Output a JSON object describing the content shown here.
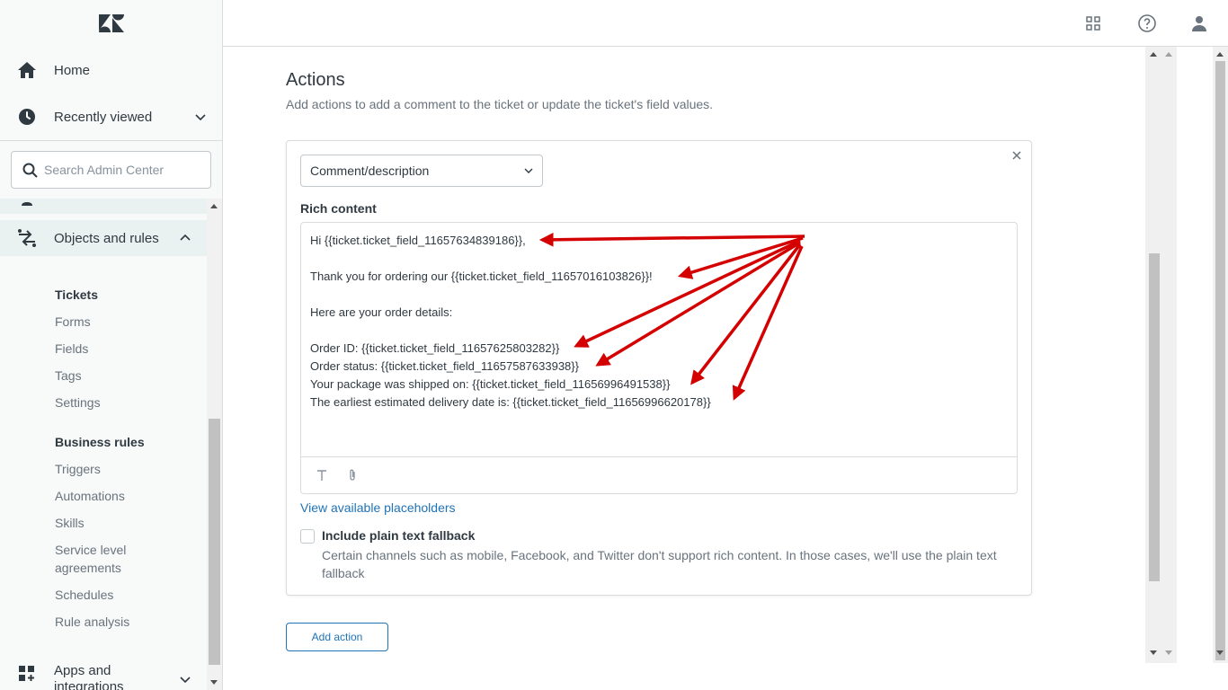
{
  "sidebar": {
    "logo": "zendesk-logo",
    "home_label": "Home",
    "recently_viewed_label": "Recently viewed",
    "search_placeholder": "Search Admin Center",
    "objects_label": "Objects and rules",
    "tickets_heading": "Tickets",
    "ticket_items": [
      "Forms",
      "Fields",
      "Tags",
      "Settings"
    ],
    "business_heading": "Business rules",
    "business_items": [
      "Triggers",
      "Automations",
      "Skills",
      "Service level",
      "agreements",
      "Schedules",
      "Rule analysis"
    ],
    "apps_label_1": "Apps and",
    "apps_label_2": "integrations"
  },
  "header": {
    "icons": [
      "products-grid-icon",
      "help-icon",
      "user-profile-icon"
    ]
  },
  "main": {
    "title": "Actions",
    "description": "Add actions to add a comment to the ticket or update the ticket's field values.",
    "action_select": "Comment/description",
    "rich_content_label": "Rich content",
    "editor_lines": [
      "Hi {{ticket.ticket_field_11657634839186}},",
      "",
      "Thank you for ordering our {{ticket.ticket_field_11657016103826}}!",
      "",
      "Here are your order details:",
      "",
      "Order ID: {{ticket.ticket_field_11657625803282}}",
      "Order status: {{ticket.ticket_field_11657587633938}}",
      "Your package was shipped on: {{ticket.ticket_field_11656996491538}}",
      "The earliest estimated delivery date is: {{ticket.ticket_field_11656996620178}}"
    ],
    "placeholders_link": "View available placeholders",
    "fallback_label": "Include plain text fallback",
    "fallback_hint": "Certain channels such as mobile, Facebook, and Twitter don't support rich content. In those cases, we'll use the plain text fallback",
    "fallback_checked": false,
    "add_action_label": "Add action"
  },
  "annotation_color": "#d40000"
}
